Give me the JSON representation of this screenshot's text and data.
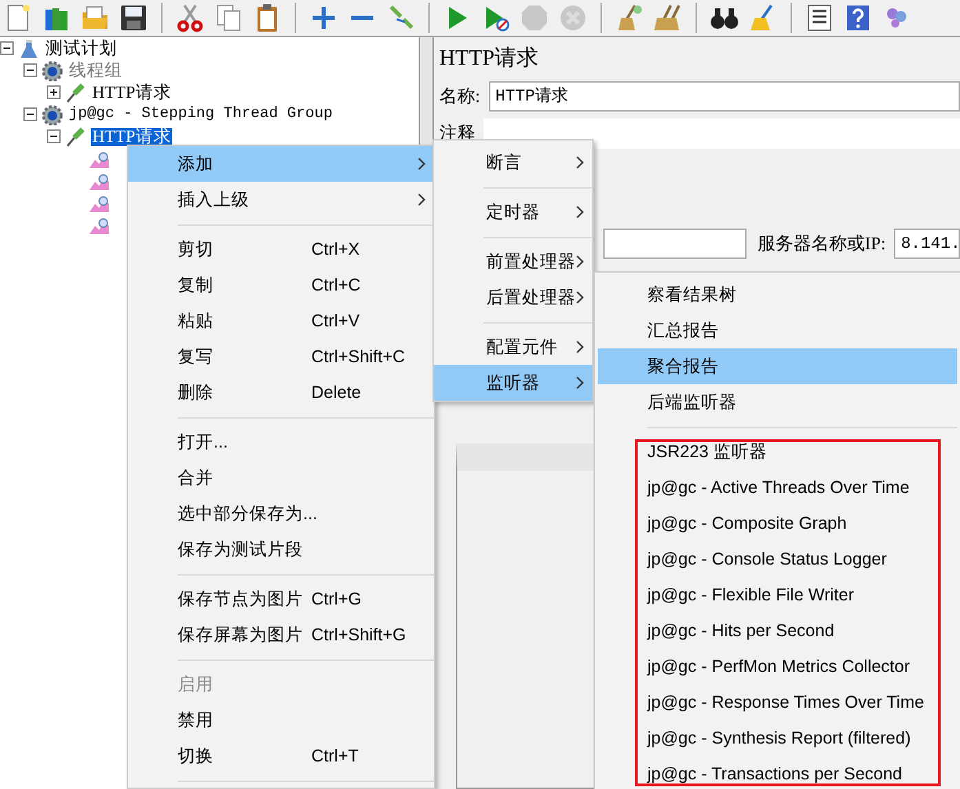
{
  "toolbar": [
    {
      "kind": "new",
      "disabled": false
    },
    {
      "kind": "templates",
      "disabled": false
    },
    {
      "kind": "open",
      "disabled": false
    },
    {
      "kind": "save",
      "disabled": false
    },
    {
      "kind": "separator"
    },
    {
      "kind": "cut",
      "disabled": false
    },
    {
      "kind": "copy",
      "disabled": false
    },
    {
      "kind": "paste",
      "disabled": false
    },
    {
      "kind": "separator"
    },
    {
      "kind": "expand",
      "disabled": false
    },
    {
      "kind": "collapse",
      "disabled": false
    },
    {
      "kind": "toggle",
      "disabled": false
    },
    {
      "kind": "separator"
    },
    {
      "kind": "start",
      "disabled": false
    },
    {
      "kind": "start-no-pause",
      "disabled": false
    },
    {
      "kind": "stop",
      "disabled": true
    },
    {
      "kind": "shutdown",
      "disabled": true
    },
    {
      "kind": "separator"
    },
    {
      "kind": "clear",
      "disabled": false
    },
    {
      "kind": "clear-all",
      "disabled": false
    },
    {
      "kind": "separator"
    },
    {
      "kind": "search",
      "disabled": false
    },
    {
      "kind": "reset",
      "disabled": false
    },
    {
      "kind": "separator"
    },
    {
      "kind": "function",
      "disabled": false
    },
    {
      "kind": "help",
      "disabled": false
    },
    {
      "kind": "remote",
      "disabled": false
    }
  ],
  "tree": [
    {
      "kind": "plan",
      "label": "测试计划",
      "expanded": true,
      "selected": false,
      "disabled": false,
      "children": [
        {
          "kind": "thread-group",
          "label": "线程组",
          "expanded": true,
          "selected": false,
          "disabled": true,
          "children": [
            {
              "kind": "sampler",
              "label": "HTTP请求",
              "expanded": false,
              "selected": false,
              "disabled": false
            }
          ]
        },
        {
          "kind": "thread-group",
          "label": "jp@gc - Stepping Thread Group",
          "expanded": true,
          "selected": false,
          "disabled": false,
          "children": [
            {
              "kind": "sampler",
              "label": "HTTP请求",
              "expanded": true,
              "selected": true,
              "disabled": false,
              "children": [
                {
                  "kind": "listener"
                },
                {
                  "kind": "listener"
                },
                {
                  "kind": "listener"
                },
                {
                  "kind": "listener"
                }
              ]
            }
          ]
        }
      ]
    }
  ],
  "panel": {
    "title": "HTTP请求",
    "name_label": "名称:",
    "name_value": "HTTP请求",
    "comment_label": "注释",
    "server_label": "服务器名称或IP:",
    "server_value": "8.141."
  },
  "context_menu": [
    {
      "kind": "item",
      "label": "添加",
      "submenu": true,
      "selected": true,
      "disabled": false
    },
    {
      "kind": "item",
      "label": "插入上级",
      "submenu": true,
      "selected": false,
      "disabled": false
    },
    {
      "kind": "separator"
    },
    {
      "kind": "item",
      "label": "剪切",
      "shortcut": "Ctrl+X",
      "submenu": false,
      "selected": false,
      "disabled": false
    },
    {
      "kind": "item",
      "label": "复制",
      "shortcut": "Ctrl+C",
      "submenu": false,
      "selected": false,
      "disabled": false
    },
    {
      "kind": "item",
      "label": "粘贴",
      "shortcut": "Ctrl+V",
      "submenu": false,
      "selected": false,
      "disabled": false
    },
    {
      "kind": "item",
      "label": "复写",
      "shortcut": "Ctrl+Shift+C",
      "submenu": false,
      "selected": false,
      "disabled": false
    },
    {
      "kind": "item",
      "label": "删除",
      "shortcut": "Delete",
      "submenu": false,
      "selected": false,
      "disabled": false
    },
    {
      "kind": "separator"
    },
    {
      "kind": "item",
      "label": "打开...",
      "submenu": false,
      "selected": false,
      "disabled": false
    },
    {
      "kind": "item",
      "label": "合并",
      "submenu": false,
      "selected": false,
      "disabled": false
    },
    {
      "kind": "item",
      "label": "选中部分保存为...",
      "submenu": false,
      "selected": false,
      "disabled": false
    },
    {
      "kind": "item",
      "label": "保存为测试片段",
      "submenu": false,
      "selected": false,
      "disabled": false
    },
    {
      "kind": "separator"
    },
    {
      "kind": "item",
      "label": "保存节点为图片",
      "shortcut": "Ctrl+G",
      "submenu": false,
      "selected": false,
      "disabled": false
    },
    {
      "kind": "item",
      "label": "保存屏幕为图片",
      "shortcut": "Ctrl+Shift+G",
      "submenu": false,
      "selected": false,
      "disabled": false
    },
    {
      "kind": "separator"
    },
    {
      "kind": "item",
      "label": "启用",
      "submenu": false,
      "selected": false,
      "disabled": true
    },
    {
      "kind": "item",
      "label": "禁用",
      "submenu": false,
      "selected": false,
      "disabled": false
    },
    {
      "kind": "item",
      "label": "切换",
      "shortcut": "Ctrl+T",
      "submenu": false,
      "selected": false,
      "disabled": false
    },
    {
      "kind": "separator"
    }
  ],
  "add_submenu": [
    {
      "kind": "item",
      "label": "断言",
      "submenu": true,
      "selected": false
    },
    {
      "kind": "separator"
    },
    {
      "kind": "item",
      "label": "定时器",
      "submenu": true,
      "selected": false
    },
    {
      "kind": "separator"
    },
    {
      "kind": "item",
      "label": "前置处理器",
      "submenu": true,
      "selected": false
    },
    {
      "kind": "item",
      "label": "后置处理器",
      "submenu": true,
      "selected": false
    },
    {
      "kind": "separator"
    },
    {
      "kind": "item",
      "label": "配置元件",
      "submenu": true,
      "selected": false
    },
    {
      "kind": "item",
      "label": "监听器",
      "submenu": true,
      "selected": true
    }
  ],
  "listener_submenu": [
    {
      "kind": "item",
      "label": "察看结果树",
      "selected": false
    },
    {
      "kind": "item",
      "label": "汇总报告",
      "selected": false
    },
    {
      "kind": "item",
      "label": "聚合报告",
      "selected": true
    },
    {
      "kind": "item",
      "label": "后端监听器",
      "selected": false
    },
    {
      "kind": "separator"
    },
    {
      "kind": "item",
      "label": "JSR223 监听器",
      "selected": false
    },
    {
      "kind": "item",
      "label": "jp@gc - Active Threads Over Time",
      "selected": false
    },
    {
      "kind": "item",
      "label": "jp@gc - Composite Graph",
      "selected": false
    },
    {
      "kind": "item",
      "label": "jp@gc - Console Status Logger",
      "selected": false
    },
    {
      "kind": "item",
      "label": "jp@gc - Flexible File Writer",
      "selected": false
    },
    {
      "kind": "item",
      "label": "jp@gc - Hits per Second",
      "selected": false
    },
    {
      "kind": "item",
      "label": "jp@gc - PerfMon Metrics Collector",
      "selected": false
    },
    {
      "kind": "item",
      "label": "jp@gc - Response Times Over Time",
      "selected": false
    },
    {
      "kind": "item",
      "label": "jp@gc - Synthesis Report (filtered)",
      "selected": false
    },
    {
      "kind": "item",
      "label": "jp@gc - Transactions per Second",
      "selected": false
    }
  ]
}
